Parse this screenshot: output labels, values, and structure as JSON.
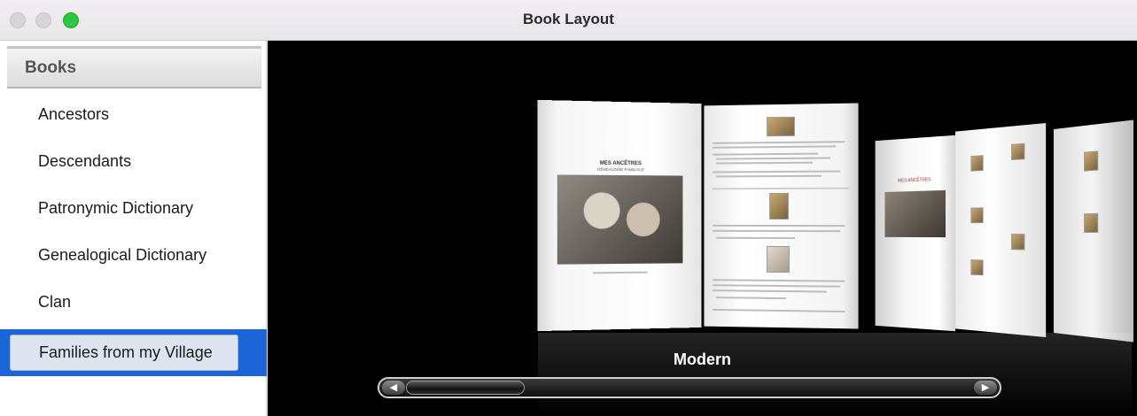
{
  "window": {
    "title": "Book Layout"
  },
  "sidebar": {
    "header": "Books",
    "items": [
      {
        "label": "Ancestors"
      },
      {
        "label": "Descendants"
      },
      {
        "label": "Patronymic Dictionary"
      },
      {
        "label": "Genealogical Dictionary"
      },
      {
        "label": "Clan"
      },
      {
        "label": "Families from my Village",
        "selected": true
      }
    ]
  },
  "coverflow": {
    "current_caption": "Modern",
    "main_book": {
      "cover_title": "MES ANCÊTRES",
      "cover_subtitle": "GÉNÉALOGIE FAMILIALE"
    },
    "second_book": {
      "cover_title": "MES ANCÊTRES"
    }
  },
  "colors": {
    "selection": "#1b65d8",
    "stage_background": "#000000",
    "zoom_button": "#2ac940"
  }
}
